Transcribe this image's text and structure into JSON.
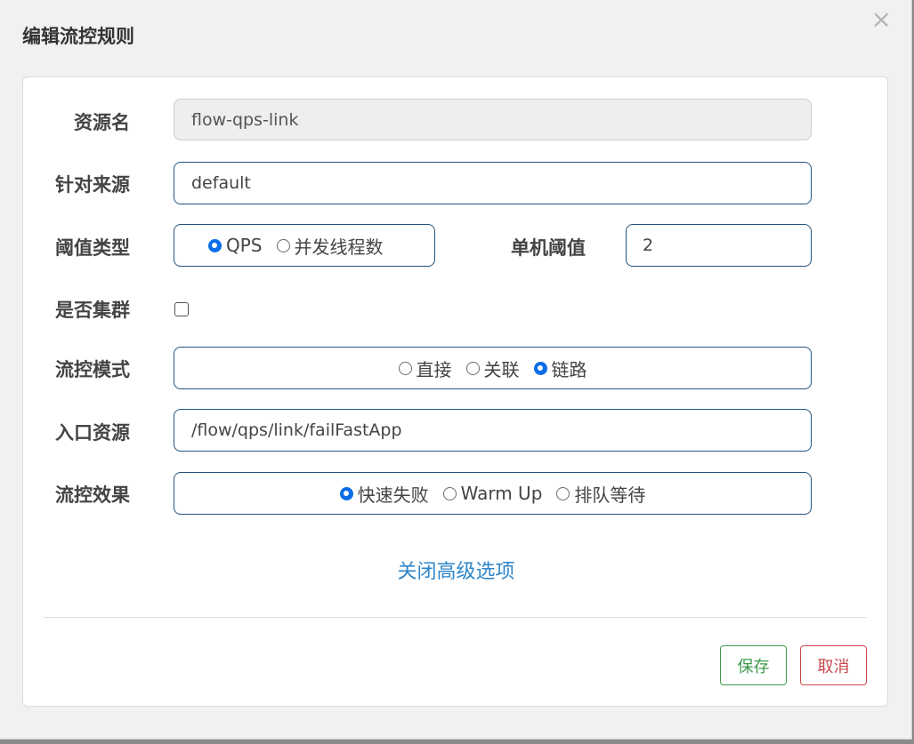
{
  "dialog": {
    "title": "编辑流控规则",
    "close_glyph": "×"
  },
  "form": {
    "resource": {
      "label": "资源名",
      "value": "flow-qps-link"
    },
    "limit_app": {
      "label": "针对来源",
      "value": "default"
    },
    "threshold_type": {
      "label": "阈值类型",
      "options": [
        "QPS",
        "并发线程数"
      ],
      "selected": "QPS"
    },
    "single_threshold": {
      "label": "单机阈值",
      "value": "2"
    },
    "cluster": {
      "label": "是否集群",
      "checked": false
    },
    "strategy": {
      "label": "流控模式",
      "options": [
        "直接",
        "关联",
        "链路"
      ],
      "selected": "链路"
    },
    "ref_resource": {
      "label": "入口资源",
      "value": "/flow/qps/link/failFastApp"
    },
    "control_behavior": {
      "label": "流控效果",
      "options": [
        "快速失败",
        "Warm Up",
        "排队等待"
      ],
      "selected": "快速失败"
    },
    "advanced_toggle": "关闭高级选项"
  },
  "buttons": {
    "save": "保存",
    "cancel": "取消"
  },
  "colors": {
    "accent_border": "#23527c",
    "radio_checked": "#0a6ee8",
    "link": "#2f86c8",
    "save": "#3d9a4a",
    "cancel": "#c9494d"
  }
}
